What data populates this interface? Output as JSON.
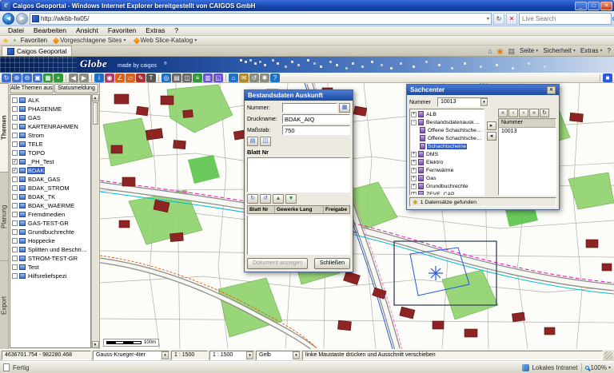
{
  "window": {
    "title": "Caigos Geoportal - Windows Internet Explorer bereitgestellt von CAIGOS GmbH"
  },
  "icons": {
    "app": "e",
    "minimize": "_",
    "maximize": "□",
    "close": "✕",
    "back": "◀",
    "forward": "▶",
    "dropdown": "▾",
    "refresh": "↻",
    "stop": "✕",
    "favorites_star": "★",
    "add_favorite": "+",
    "home": "⌂",
    "feeds": "◉",
    "print": "▤",
    "help": "?",
    "scroll_up": "▲",
    "scroll_down": "▼",
    "table": "▦",
    "sheet": "▤",
    "disk": "◫",
    "refresh_cw": "↻",
    "refresh_ccw": "↺",
    "arrow_up": "▲",
    "arrow_down": "▼",
    "nav_first": "«",
    "nav_prev": "‹",
    "nav_next": "›",
    "nav_last": "»",
    "move_right": "▸",
    "move_left": "◂",
    "asterisk": "✱"
  },
  "browser": {
    "url": "http://wk6b-fw05/",
    "search_placeholder": "Live Search",
    "menu": [
      {
        "label": "Datei",
        "name": "menu-datei"
      },
      {
        "label": "Bearbeiten",
        "name": "menu-bearbeiten"
      },
      {
        "label": "Ansicht",
        "name": "menu-ansicht"
      },
      {
        "label": "Favoriten",
        "name": "menu-favoriten"
      },
      {
        "label": "Extras",
        "name": "menu-extras"
      },
      {
        "label": "?",
        "name": "menu-hilfe"
      }
    ],
    "favorites": {
      "button": "Favoriten",
      "items": [
        {
          "label": "Vorgeschlagene Sites",
          "name": "favbar-vorgeschlagene-sites"
        },
        {
          "label": "Web Slice-Katalog",
          "name": "favbar-web-slice-katalog"
        }
      ]
    },
    "tab": "Caigos Geoportal",
    "commands": [
      {
        "label": "Seite",
        "name": "command-seite"
      },
      {
        "label": "Sicherheit",
        "name": "command-sicherheit"
      },
      {
        "label": "Extras",
        "name": "command-extras"
      }
    ],
    "status": {
      "left": "Fertig",
      "zone": "Lokales Intranet",
      "zoom": "100%"
    }
  },
  "banner": {
    "logo_main": "Globe",
    "logo_sub": "made by caigos",
    "logo_reg": "®"
  },
  "toolbar": {
    "icons": [
      {
        "name": "redraw-icon",
        "glyph": "↻",
        "bg": "#3f6fd0"
      },
      {
        "name": "zoom-in-icon",
        "glyph": "⊕",
        "bg": "#3f6fd0"
      },
      {
        "name": "zoom-out-icon",
        "glyph": "⊖",
        "bg": "#3f6fd0"
      },
      {
        "name": "zoom-window-icon",
        "glyph": "▣",
        "bg": "#3f6fd0"
      },
      {
        "name": "zoom-full-extent-icon",
        "glyph": "▦",
        "bg": "#33973b"
      },
      {
        "name": "pan-icon",
        "glyph": "+",
        "bg": "#33973b"
      },
      {
        "sep": true
      },
      {
        "name": "previous-view-icon",
        "glyph": "◀",
        "bg": "#8b8b84"
      },
      {
        "name": "next-view-icon",
        "glyph": "▶",
        "bg": "#8b8b84"
      },
      {
        "sep": true
      },
      {
        "name": "info-icon",
        "glyph": "i",
        "bg": "#1f6fc4"
      },
      {
        "name": "select-icon",
        "glyph": "◉",
        "bg": "#b43a6e"
      },
      {
        "name": "measure-length-icon",
        "glyph": "∠",
        "bg": "#d9641e"
      },
      {
        "name": "measure-area-icon",
        "glyph": "▱",
        "bg": "#d9641e"
      },
      {
        "name": "redline-icon",
        "glyph": "✎",
        "bg": "#a83232"
      },
      {
        "name": "text-annotation-icon",
        "glyph": "T",
        "bg": "#555555"
      },
      {
        "sep": true
      },
      {
        "name": "search-icon",
        "glyph": "◎",
        "bg": "#1f6fc4"
      },
      {
        "name": "print-icon",
        "glyph": "▤",
        "bg": "#666666"
      },
      {
        "name": "save-icon",
        "glyph": "◫",
        "bg": "#666666"
      },
      {
        "name": "layers-icon",
        "glyph": "≡",
        "bg": "#33973b"
      },
      {
        "name": "legend-icon",
        "glyph": "▥",
        "bg": "#6a4fd0"
      },
      {
        "name": "overview-map-icon",
        "glyph": "◱",
        "bg": "#6a4fd0"
      },
      {
        "sep": true
      },
      {
        "name": "home-view-icon",
        "glyph": "⌂",
        "bg": "#1f6fc4"
      },
      {
        "name": "mail-icon",
        "glyph": "✉",
        "bg": "#b08a2a"
      },
      {
        "name": "undo-icon",
        "glyph": "↺",
        "bg": "#8b8b84"
      },
      {
        "name": "settings-icon",
        "glyph": "✱",
        "bg": "#8b8b84"
      },
      {
        "name": "help-tool-icon",
        "glyph": "?",
        "bg": "#1f6fc4"
      },
      {
        "sep": true,
        "right": true
      },
      {
        "name": "dock-panel-icon",
        "glyph": "■",
        "bg": "#2b59d8"
      }
    ]
  },
  "panels": {
    "vertical_tabs": [
      {
        "label": "Themen",
        "name": "vtab-themen",
        "active": true
      },
      {
        "label": "Planung",
        "name": "vtab-planung"
      },
      {
        "label": "Export",
        "name": "vtab-export"
      }
    ]
  },
  "sidebar": {
    "tabs": [
      {
        "label": "Alle Themen aus"
      },
      {
        "label": "Statusmeldung"
      }
    ],
    "tree": [
      {
        "label": "ALK"
      },
      {
        "label": "PHASENME"
      },
      {
        "label": "GAS"
      },
      {
        "label": "KARTENRAHMEN"
      },
      {
        "label": "Strom"
      },
      {
        "label": "TELE"
      },
      {
        "label": "TOPO"
      },
      {
        "label": "_PH_Test",
        "checked": true
      },
      {
        "label": "BDAK",
        "checked": true,
        "selected": true
      },
      {
        "label": "BDAK_GAS"
      },
      {
        "label": "BDAK_STROM"
      },
      {
        "label": "BDAK_TK"
      },
      {
        "label": "BDAK_WAERME"
      },
      {
        "label": "Fremdmedien"
      },
      {
        "label": "GAS-TEST-GR"
      },
      {
        "label": "Grundbuchrechte"
      },
      {
        "label": "Hoppecke"
      },
      {
        "label": "Splitten und Beschriftungstest"
      },
      {
        "label": "STROM-TEST-GR"
      },
      {
        "label": "Test"
      },
      {
        "label": "Hilfsreliefspezi"
      }
    ]
  },
  "dialog": {
    "title": "Bestandsdaten Auskunft",
    "nummer_label": "Nummer:",
    "nummer_value": "",
    "druckname_label": "Druckname:",
    "druckname_value": "BDAK_AIQ",
    "massstab_label": "Maßstab:",
    "massstab_value": "750",
    "section": "Blatt Nr",
    "columns": [
      {
        "label": "Blatt Nr"
      },
      {
        "label": "Gewerke Lang"
      },
      {
        "label": "Freigabe"
      }
    ],
    "buttons": {
      "open": "Dokument anzeigen",
      "close": "Schließen"
    }
  },
  "sachcenter": {
    "title": "Sachcenter",
    "nummer_label": "Nummer",
    "nummer_value": "10013",
    "tree": [
      {
        "label": "ALB",
        "level": 1
      },
      {
        "label": "Bestandsdatenauskunft",
        "level": 1,
        "expanded": true
      },
      {
        "label": "Offene Schachtscheine nach Verw",
        "level": 2
      },
      {
        "label": "Offene Schachtscheine (alle)",
        "level": 2
      },
      {
        "label": "Schachtscheine",
        "level": 2,
        "selected": true
      },
      {
        "label": "DMS",
        "level": 1
      },
      {
        "label": "Elektro",
        "level": 1
      },
      {
        "label": "Fernwärme",
        "level": 1
      },
      {
        "label": "Gas",
        "level": 1
      },
      {
        "label": "Grundbuchrechte",
        "level": 1
      },
      {
        "label": "ZEVE_CAP",
        "level": 1
      }
    ],
    "grid_header": "Nummer",
    "grid_rows": [
      {
        "value": "10013"
      }
    ],
    "status": "1 Datensätze gefunden"
  },
  "statusbar": {
    "coords": "4636701.754 - 982280.468",
    "crs": "Gauss-Krueger-4ter",
    "scale_label": "1 : 1500",
    "scale_value": "1 : 1500",
    "color_value": "Gelb",
    "hint": "linke Maustaste drücken und Ausschnitt verschieben"
  },
  "map": {
    "scalebar_label": "100m"
  }
}
